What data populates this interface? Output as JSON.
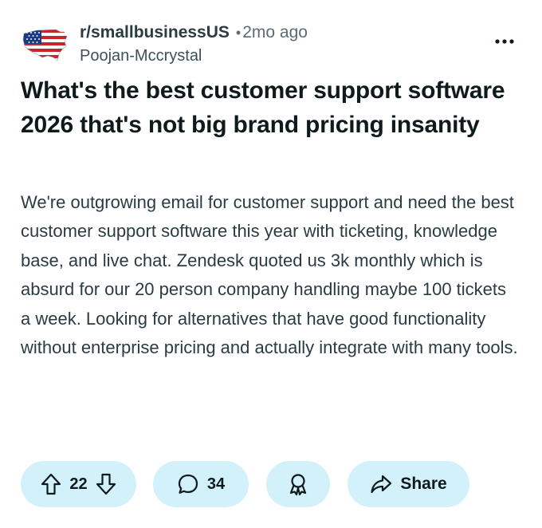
{
  "post": {
    "subreddit": "r/smallbusinessUS",
    "separator": "•",
    "time_ago": "2mo ago",
    "author": "Poojan-Mccrystal",
    "title": "What's the best customer support software 2026 that's not big brand pricing insanity",
    "body": "We're outgrowing email for customer support and need the best customer support software this year with ticketing, knowledge base, and live chat. Zendesk quoted us 3k monthly which is absurd for our 20 person company handling maybe 100 tickets a week. Looking for alternatives that have good functionality without enterprise pricing and actually integrate with many tools."
  },
  "actions": {
    "vote_count": "22",
    "comment_count": "34",
    "share_label": "Share"
  },
  "icons": {
    "avatar": "us-flag-map-icon",
    "more": "more-horizontal-icon",
    "upvote": "upvote-arrow-icon",
    "downvote": "downvote-arrow-icon",
    "comment": "comment-bubble-icon",
    "award": "award-ribbon-icon",
    "share": "share-arrow-icon"
  },
  "colors": {
    "pill_background": "#d3f1fb",
    "text_primary": "#0f1a1c",
    "text_secondary": "#5c6c74"
  }
}
